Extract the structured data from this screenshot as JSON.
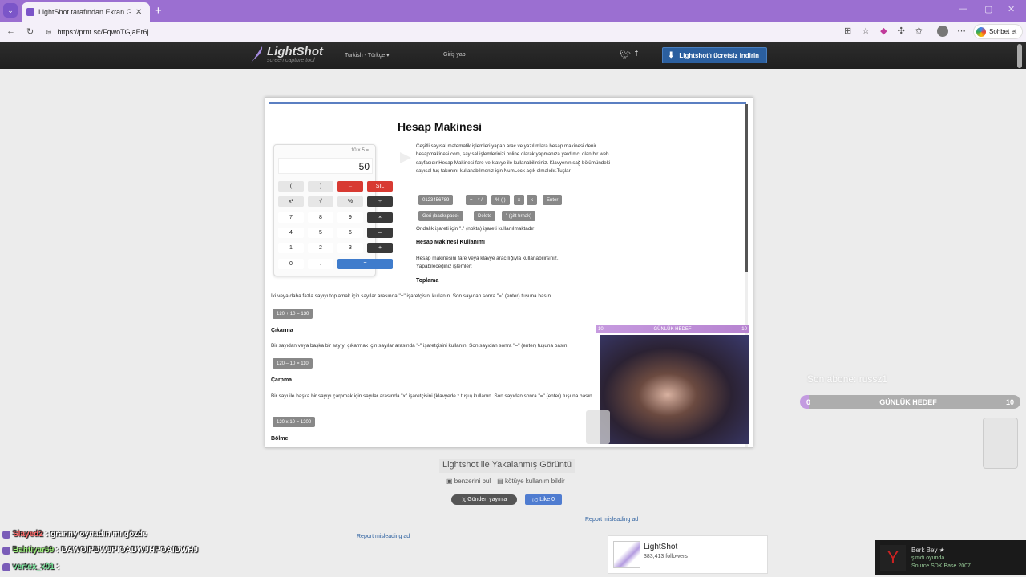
{
  "browser": {
    "tab_title": "LightShot tarafından Ekran Görüntüsü",
    "url": "https://prnt.sc/FqwoTGjaEr6j",
    "chat_button": "Sohbet et"
  },
  "site": {
    "logo_name": "LightShot",
    "logo_tagline": "screen capture tool",
    "language": "Turkish - Türkçe",
    "login": "Giriş yap",
    "download_button": "Lightshot'ı ücretsiz indirin"
  },
  "screenshot": {
    "title": "Hesap Makinesi",
    "calculator": {
      "expression": "10 × 5 =",
      "display": "50",
      "keys": [
        {
          "label": "(",
          "style": "light"
        },
        {
          "label": ")",
          "style": "light"
        },
        {
          "label": "←",
          "style": "red"
        },
        {
          "label": "SIL",
          "style": "red"
        },
        {
          "label": "x²",
          "style": "light"
        },
        {
          "label": "√",
          "style": "light"
        },
        {
          "label": "%",
          "style": "light"
        },
        {
          "label": "÷",
          "style": "dark"
        },
        {
          "label": "7",
          "style": "white"
        },
        {
          "label": "8",
          "style": "white"
        },
        {
          "label": "9",
          "style": "white"
        },
        {
          "label": "×",
          "style": "dark"
        },
        {
          "label": "4",
          "style": "white"
        },
        {
          "label": "5",
          "style": "white"
        },
        {
          "label": "6",
          "style": "white"
        },
        {
          "label": "–",
          "style": "dark"
        },
        {
          "label": "1",
          "style": "white"
        },
        {
          "label": "2",
          "style": "white"
        },
        {
          "label": "3",
          "style": "white"
        },
        {
          "label": "+",
          "style": "dark"
        },
        {
          "label": "0",
          "style": "white"
        },
        {
          "label": ".",
          "style": "white"
        },
        {
          "label": "=",
          "style": "blue"
        }
      ]
    },
    "description": "Çeşitli sayısal matematik işlemleri yapan araç ve yazılımlara hesap makinesi denir. hesapmakinesi.com, sayısal işlemlerinizi online olarak yapmanıza yardımcı olan bir web sayfasıdır.Hesap Makinesi fare ve klavye ile kullanabilirsiniz. Klavyenin sağ bölümündeki sayısal tuş takımını kullanabilmeniz için NumLock açık olmalıdır.Tuşlar",
    "key_chips": [
      "0123456789",
      "+ – * /",
      "% ( )",
      "x",
      "k",
      "Enter",
      "Geri (backspace)",
      "Delete",
      "\" (çift tırnak)"
    ],
    "decimal_note": "Ondalık işareti için \".\" (nokta) işareti kullanılmaktadır",
    "usage_heading": "Hesap Makinesi Kullanımı",
    "usage_text": "Hesap makinesini fare veya klavye aracılığıyla kullanabilirsiniz. Yapabileceğiniz işlemler;",
    "add_heading": "Toplama",
    "add_text": "İki veya daha fazla sayıyı toplamak için sayılar arasında \"+\" işaretçisini kullanın. Son sayıdan sonra \"=\" (enter) tuşuna basın.",
    "add_example": "120 + 10 = 130",
    "sub_heading": "Çıkarma",
    "sub_text": "Bir sayıdan veya başka bir sayıyı çıkarmak için sayılar arasında \"-\" işaretçisini kullanın. Son sayıdan sonra \"=\" (enter) tuşuna basın.",
    "sub_example": "120 – 10 = 110",
    "mul_heading": "Çarpma",
    "mul_text": "Bir sayı ile başka bir sayıyı çarpmak için sayılar arasında \"x\" işaretçisini (klavyede * tuşu) kullanın. Son sayıdan sonra \"=\" (enter) tuşuna basın.",
    "mul_example": "120 x 10 = 1200",
    "div_heading": "Bölme"
  },
  "stream": {
    "goal_small_label": "GÜNLÜK HEDEF",
    "goal_small_left": "10",
    "goal_small_right": "10",
    "last_sub": "Son abone: russz1",
    "goal_big_label": "GÜNLÜK HEDEF",
    "goal_big_left": "0",
    "goal_big_right": "10",
    "goal_progress": 0
  },
  "page": {
    "caption": "Lightshot ile Yakalanmış Görüntü",
    "find_similar": "benzerini bul",
    "report_abuse": "kötüye kullanım bildir",
    "tweet": "Gönderi yayınla",
    "like": "Like 0",
    "report_ad": "Report misleading ad",
    "fb_name": "LightShot",
    "fb_followers": "383,413 followers"
  },
  "chat": [
    {
      "user": "Slayed2",
      "message": "granny oynadın mı gözde",
      "color": "#ff6b6b"
    },
    {
      "user": "Bahtiyar69",
      "message": "DAWOIPDWJPIOADWJHPOAIDWHJ",
      "color": "#9cf07a"
    },
    {
      "user": "vertex_x01",
      "message": "",
      "color": "#7ee8a0"
    }
  ],
  "game_notification": {
    "name": "Berk Bey ★",
    "status": "şimdi oyunda",
    "game": "Source SDK Base 2007"
  }
}
